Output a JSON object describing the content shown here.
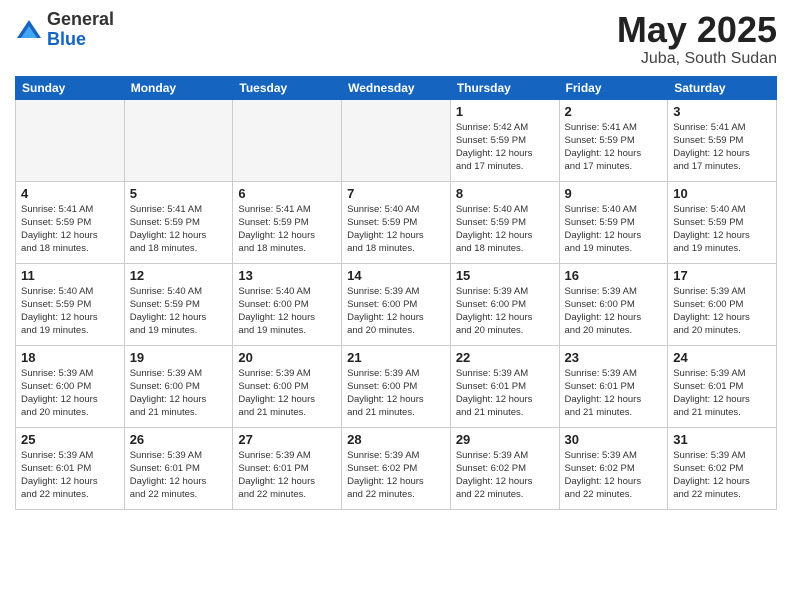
{
  "logo": {
    "general": "General",
    "blue": "Blue"
  },
  "title": "May 2025",
  "location": "Juba, South Sudan",
  "days_of_week": [
    "Sunday",
    "Monday",
    "Tuesday",
    "Wednesday",
    "Thursday",
    "Friday",
    "Saturday"
  ],
  "weeks": [
    [
      {
        "day": "",
        "info": ""
      },
      {
        "day": "",
        "info": ""
      },
      {
        "day": "",
        "info": ""
      },
      {
        "day": "",
        "info": ""
      },
      {
        "day": "1",
        "info": "Sunrise: 5:42 AM\nSunset: 5:59 PM\nDaylight: 12 hours\nand 17 minutes."
      },
      {
        "day": "2",
        "info": "Sunrise: 5:41 AM\nSunset: 5:59 PM\nDaylight: 12 hours\nand 17 minutes."
      },
      {
        "day": "3",
        "info": "Sunrise: 5:41 AM\nSunset: 5:59 PM\nDaylight: 12 hours\nand 17 minutes."
      }
    ],
    [
      {
        "day": "4",
        "info": "Sunrise: 5:41 AM\nSunset: 5:59 PM\nDaylight: 12 hours\nand 18 minutes."
      },
      {
        "day": "5",
        "info": "Sunrise: 5:41 AM\nSunset: 5:59 PM\nDaylight: 12 hours\nand 18 minutes."
      },
      {
        "day": "6",
        "info": "Sunrise: 5:41 AM\nSunset: 5:59 PM\nDaylight: 12 hours\nand 18 minutes."
      },
      {
        "day": "7",
        "info": "Sunrise: 5:40 AM\nSunset: 5:59 PM\nDaylight: 12 hours\nand 18 minutes."
      },
      {
        "day": "8",
        "info": "Sunrise: 5:40 AM\nSunset: 5:59 PM\nDaylight: 12 hours\nand 18 minutes."
      },
      {
        "day": "9",
        "info": "Sunrise: 5:40 AM\nSunset: 5:59 PM\nDaylight: 12 hours\nand 19 minutes."
      },
      {
        "day": "10",
        "info": "Sunrise: 5:40 AM\nSunset: 5:59 PM\nDaylight: 12 hours\nand 19 minutes."
      }
    ],
    [
      {
        "day": "11",
        "info": "Sunrise: 5:40 AM\nSunset: 5:59 PM\nDaylight: 12 hours\nand 19 minutes."
      },
      {
        "day": "12",
        "info": "Sunrise: 5:40 AM\nSunset: 5:59 PM\nDaylight: 12 hours\nand 19 minutes."
      },
      {
        "day": "13",
        "info": "Sunrise: 5:40 AM\nSunset: 6:00 PM\nDaylight: 12 hours\nand 19 minutes."
      },
      {
        "day": "14",
        "info": "Sunrise: 5:39 AM\nSunset: 6:00 PM\nDaylight: 12 hours\nand 20 minutes."
      },
      {
        "day": "15",
        "info": "Sunrise: 5:39 AM\nSunset: 6:00 PM\nDaylight: 12 hours\nand 20 minutes."
      },
      {
        "day": "16",
        "info": "Sunrise: 5:39 AM\nSunset: 6:00 PM\nDaylight: 12 hours\nand 20 minutes."
      },
      {
        "day": "17",
        "info": "Sunrise: 5:39 AM\nSunset: 6:00 PM\nDaylight: 12 hours\nand 20 minutes."
      }
    ],
    [
      {
        "day": "18",
        "info": "Sunrise: 5:39 AM\nSunset: 6:00 PM\nDaylight: 12 hours\nand 20 minutes."
      },
      {
        "day": "19",
        "info": "Sunrise: 5:39 AM\nSunset: 6:00 PM\nDaylight: 12 hours\nand 21 minutes."
      },
      {
        "day": "20",
        "info": "Sunrise: 5:39 AM\nSunset: 6:00 PM\nDaylight: 12 hours\nand 21 minutes."
      },
      {
        "day": "21",
        "info": "Sunrise: 5:39 AM\nSunset: 6:00 PM\nDaylight: 12 hours\nand 21 minutes."
      },
      {
        "day": "22",
        "info": "Sunrise: 5:39 AM\nSunset: 6:01 PM\nDaylight: 12 hours\nand 21 minutes."
      },
      {
        "day": "23",
        "info": "Sunrise: 5:39 AM\nSunset: 6:01 PM\nDaylight: 12 hours\nand 21 minutes."
      },
      {
        "day": "24",
        "info": "Sunrise: 5:39 AM\nSunset: 6:01 PM\nDaylight: 12 hours\nand 21 minutes."
      }
    ],
    [
      {
        "day": "25",
        "info": "Sunrise: 5:39 AM\nSunset: 6:01 PM\nDaylight: 12 hours\nand 22 minutes."
      },
      {
        "day": "26",
        "info": "Sunrise: 5:39 AM\nSunset: 6:01 PM\nDaylight: 12 hours\nand 22 minutes."
      },
      {
        "day": "27",
        "info": "Sunrise: 5:39 AM\nSunset: 6:01 PM\nDaylight: 12 hours\nand 22 minutes."
      },
      {
        "day": "28",
        "info": "Sunrise: 5:39 AM\nSunset: 6:02 PM\nDaylight: 12 hours\nand 22 minutes."
      },
      {
        "day": "29",
        "info": "Sunrise: 5:39 AM\nSunset: 6:02 PM\nDaylight: 12 hours\nand 22 minutes."
      },
      {
        "day": "30",
        "info": "Sunrise: 5:39 AM\nSunset: 6:02 PM\nDaylight: 12 hours\nand 22 minutes."
      },
      {
        "day": "31",
        "info": "Sunrise: 5:39 AM\nSunset: 6:02 PM\nDaylight: 12 hours\nand 22 minutes."
      }
    ]
  ]
}
